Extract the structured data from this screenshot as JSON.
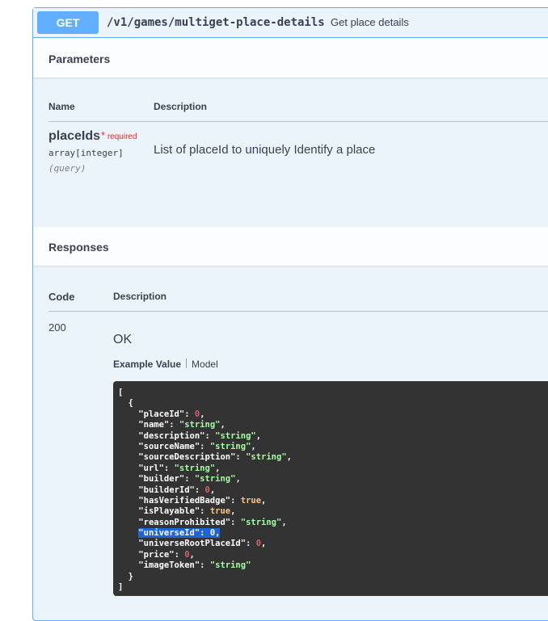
{
  "operation": {
    "method": "GET",
    "path": "/v1/games/multiget-place-details",
    "summary": "Get place details"
  },
  "parameters": {
    "section_title": "Parameters",
    "col_name": "Name",
    "col_description": "Description",
    "items": [
      {
        "name": "placeIds",
        "required_star": "*",
        "required_label": "required",
        "type": "array[integer]",
        "in": "(query)",
        "description": "List of placeId to uniquely Identify a place"
      }
    ]
  },
  "responses": {
    "section_title": "Responses",
    "col_code": "Code",
    "col_description": "Description",
    "items": [
      {
        "code": "200",
        "description": "OK",
        "tab_example": "Example Value",
        "tab_model": "Model",
        "example_lines": [
          {
            "indent": "",
            "key": "",
            "value": "[",
            "vtype": "punct",
            "comma": ""
          },
          {
            "indent": "  ",
            "key": "",
            "value": "{",
            "vtype": "punct",
            "comma": ""
          },
          {
            "indent": "    ",
            "key": "\"placeId\"",
            "value": "0",
            "vtype": "num",
            "comma": ","
          },
          {
            "indent": "    ",
            "key": "\"name\"",
            "value": "\"string\"",
            "vtype": "str",
            "comma": ","
          },
          {
            "indent": "    ",
            "key": "\"description\"",
            "value": "\"string\"",
            "vtype": "str",
            "comma": ","
          },
          {
            "indent": "    ",
            "key": "\"sourceName\"",
            "value": "\"string\"",
            "vtype": "str",
            "comma": ","
          },
          {
            "indent": "    ",
            "key": "\"sourceDescription\"",
            "value": "\"string\"",
            "vtype": "str",
            "comma": ","
          },
          {
            "indent": "    ",
            "key": "\"url\"",
            "value": "\"string\"",
            "vtype": "str",
            "comma": ","
          },
          {
            "indent": "    ",
            "key": "\"builder\"",
            "value": "\"string\"",
            "vtype": "str",
            "comma": ","
          },
          {
            "indent": "    ",
            "key": "\"builderId\"",
            "value": "0",
            "vtype": "num",
            "comma": ","
          },
          {
            "indent": "    ",
            "key": "\"hasVerifiedBadge\"",
            "value": "true",
            "vtype": "bool",
            "comma": ","
          },
          {
            "indent": "    ",
            "key": "\"isPlayable\"",
            "value": "true",
            "vtype": "bool",
            "comma": ","
          },
          {
            "indent": "    ",
            "key": "\"reasonProhibited\"",
            "value": "\"string\"",
            "vtype": "str",
            "comma": ","
          },
          {
            "indent": "    ",
            "key": "\"universeId\"",
            "value": "0",
            "vtype": "highlight",
            "comma": ","
          },
          {
            "indent": "    ",
            "key": "\"universeRootPlaceId\"",
            "value": "0",
            "vtype": "num",
            "comma": ","
          },
          {
            "indent": "    ",
            "key": "\"price\"",
            "value": "0",
            "vtype": "num",
            "comma": ","
          },
          {
            "indent": "    ",
            "key": "\"imageToken\"",
            "value": "\"string\"",
            "vtype": "str",
            "comma": ""
          },
          {
            "indent": "  ",
            "key": "",
            "value": "}",
            "vtype": "punct",
            "comma": ""
          },
          {
            "indent": "",
            "key": "",
            "value": "]",
            "vtype": "punct",
            "comma": ""
          }
        ]
      }
    ]
  },
  "colors": {
    "get_accent": "#61affe",
    "opblock_bg": "#ebf3fb",
    "code_bg": "#333333",
    "string_color": "#a2fca2",
    "number_color": "#d36363",
    "bool_color": "#fcc28c",
    "highlight": "#1e64d4"
  }
}
